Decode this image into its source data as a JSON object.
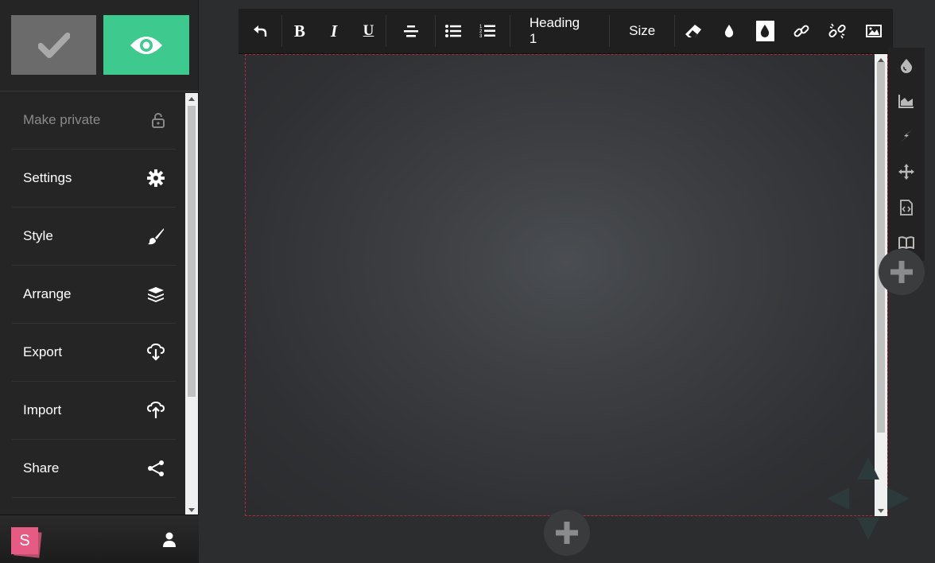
{
  "sidebar": {
    "items": [
      {
        "label": "Make private",
        "icon": "lock-icon",
        "disabled": true
      },
      {
        "label": "Settings",
        "icon": "gear-icon"
      },
      {
        "label": "Style",
        "icon": "brush-icon"
      },
      {
        "label": "Arrange",
        "icon": "layers-icon"
      },
      {
        "label": "Export",
        "icon": "cloud-download-icon"
      },
      {
        "label": "Import",
        "icon": "cloud-upload-icon"
      },
      {
        "label": "Share",
        "icon": "share-icon"
      }
    ],
    "logo_letter": "S"
  },
  "toolbar": {
    "heading_label": "Heading 1",
    "size_label": "Size"
  },
  "colors": {
    "accent_green": "#3ec98e",
    "logo_pink": "#e55b83",
    "canvas_border": "#b3283a"
  }
}
